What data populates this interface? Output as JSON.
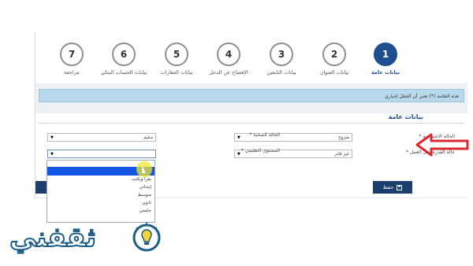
{
  "steps": [
    {
      "n": "1",
      "label": "بيانات عامة",
      "active": true
    },
    {
      "n": "2",
      "label": "بيانات العنوان",
      "active": false
    },
    {
      "n": "3",
      "label": "بيانات التابعين",
      "active": false
    },
    {
      "n": "4",
      "label": "الإفصاح عن الدخل",
      "active": false
    },
    {
      "n": "5",
      "label": "بيانات العقارات",
      "active": false
    },
    {
      "n": "6",
      "label": "بيانات الحساب البنكي",
      "active": false
    },
    {
      "n": "7",
      "label": "مراجعة",
      "active": false
    }
  ],
  "notice": "هذه العلامة (*) تعني أن الحقل إجباري",
  "section_title": "بيانات عامة",
  "fields": {
    "marital_label": "الحالة الاجتماعية *",
    "marital_value": "متزوج",
    "health_label": "الحالة الصحية *",
    "health_value": "سليم",
    "work_label": "حالة القدرة على العمل *",
    "work_value": "غير قادر",
    "edu_label": "المستوى التعليمي *",
    "edu_value": ""
  },
  "dropdown_options": [
    "يقرأ ويكتب",
    "إبتدائي",
    "متوسط",
    "ثانوي",
    "جامعي"
  ],
  "save_label": "حفظ",
  "logo_text": "ثقفني",
  "colors": {
    "accent": "#1d4f91",
    "notice_bg": "#b8d8ec",
    "arrow": "#d9282f",
    "highlight": "#1457e4"
  }
}
